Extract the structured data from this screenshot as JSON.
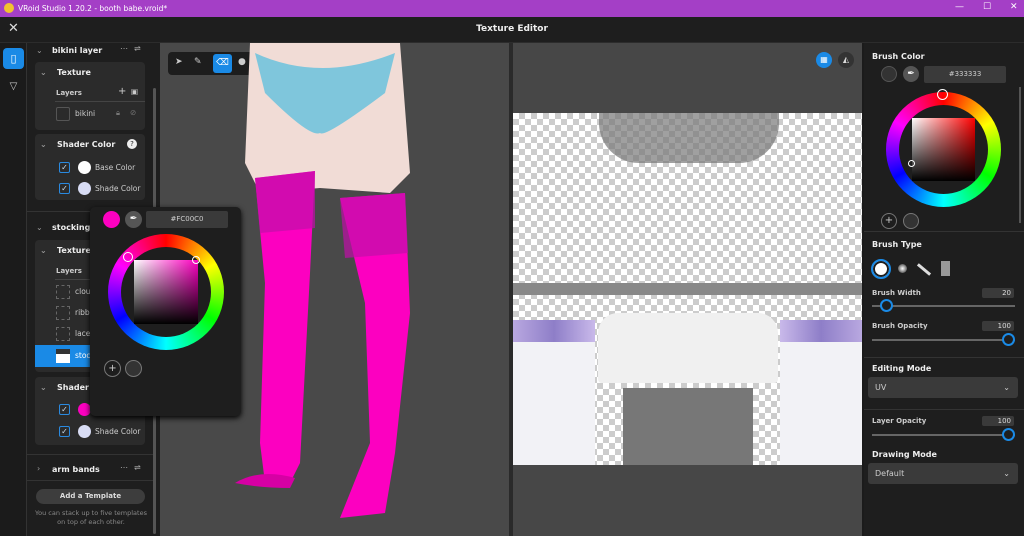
{
  "window": {
    "title": "VRoid Studio 1.20.2 - booth babe.vroid*",
    "minimize": "—",
    "maximize": "☐",
    "close": "✕"
  },
  "header": {
    "title": "Texture Editor",
    "close": "✕"
  },
  "left_panel": {
    "group1": {
      "name": "bikini layer",
      "texture": "Texture",
      "layers_label": "Layers",
      "layers": [
        "bikini"
      ],
      "shader_color": "Shader Color",
      "base_color": "Base Color",
      "shade_color": "Shade Color"
    },
    "group2": {
      "name": "stocking la",
      "texture": "Texture",
      "layers_label": "Layers",
      "layers": [
        "clou",
        "ribb",
        "lace",
        "stoc"
      ],
      "shader_color": "Shader C",
      "shade_color": "Shade Color"
    },
    "group3": {
      "name": "arm bands"
    },
    "add_template": "Add a Template",
    "hint": "You can stack up to five templates on top of each other."
  },
  "popup_color": {
    "hex": "#FC00C0",
    "swatch": "#fc00c0"
  },
  "right_panel": {
    "brush_color": "Brush Color",
    "brush_hex": "#333333",
    "brush_type": "Brush Type",
    "brush_width_label": "Brush Width",
    "brush_width": "20",
    "brush_opacity_label": "Brush Opacity",
    "brush_opacity": "100",
    "editing_mode_label": "Editing Mode",
    "editing_mode": "UV",
    "layer_opacity_label": "Layer Opacity",
    "layer_opacity": "100",
    "drawing_mode_label": "Drawing Mode",
    "drawing_mode": "Default"
  },
  "colors": {
    "accent": "#1a8ae6",
    "titlebar": "#a43fc6",
    "stocking": "#fc00c0"
  }
}
